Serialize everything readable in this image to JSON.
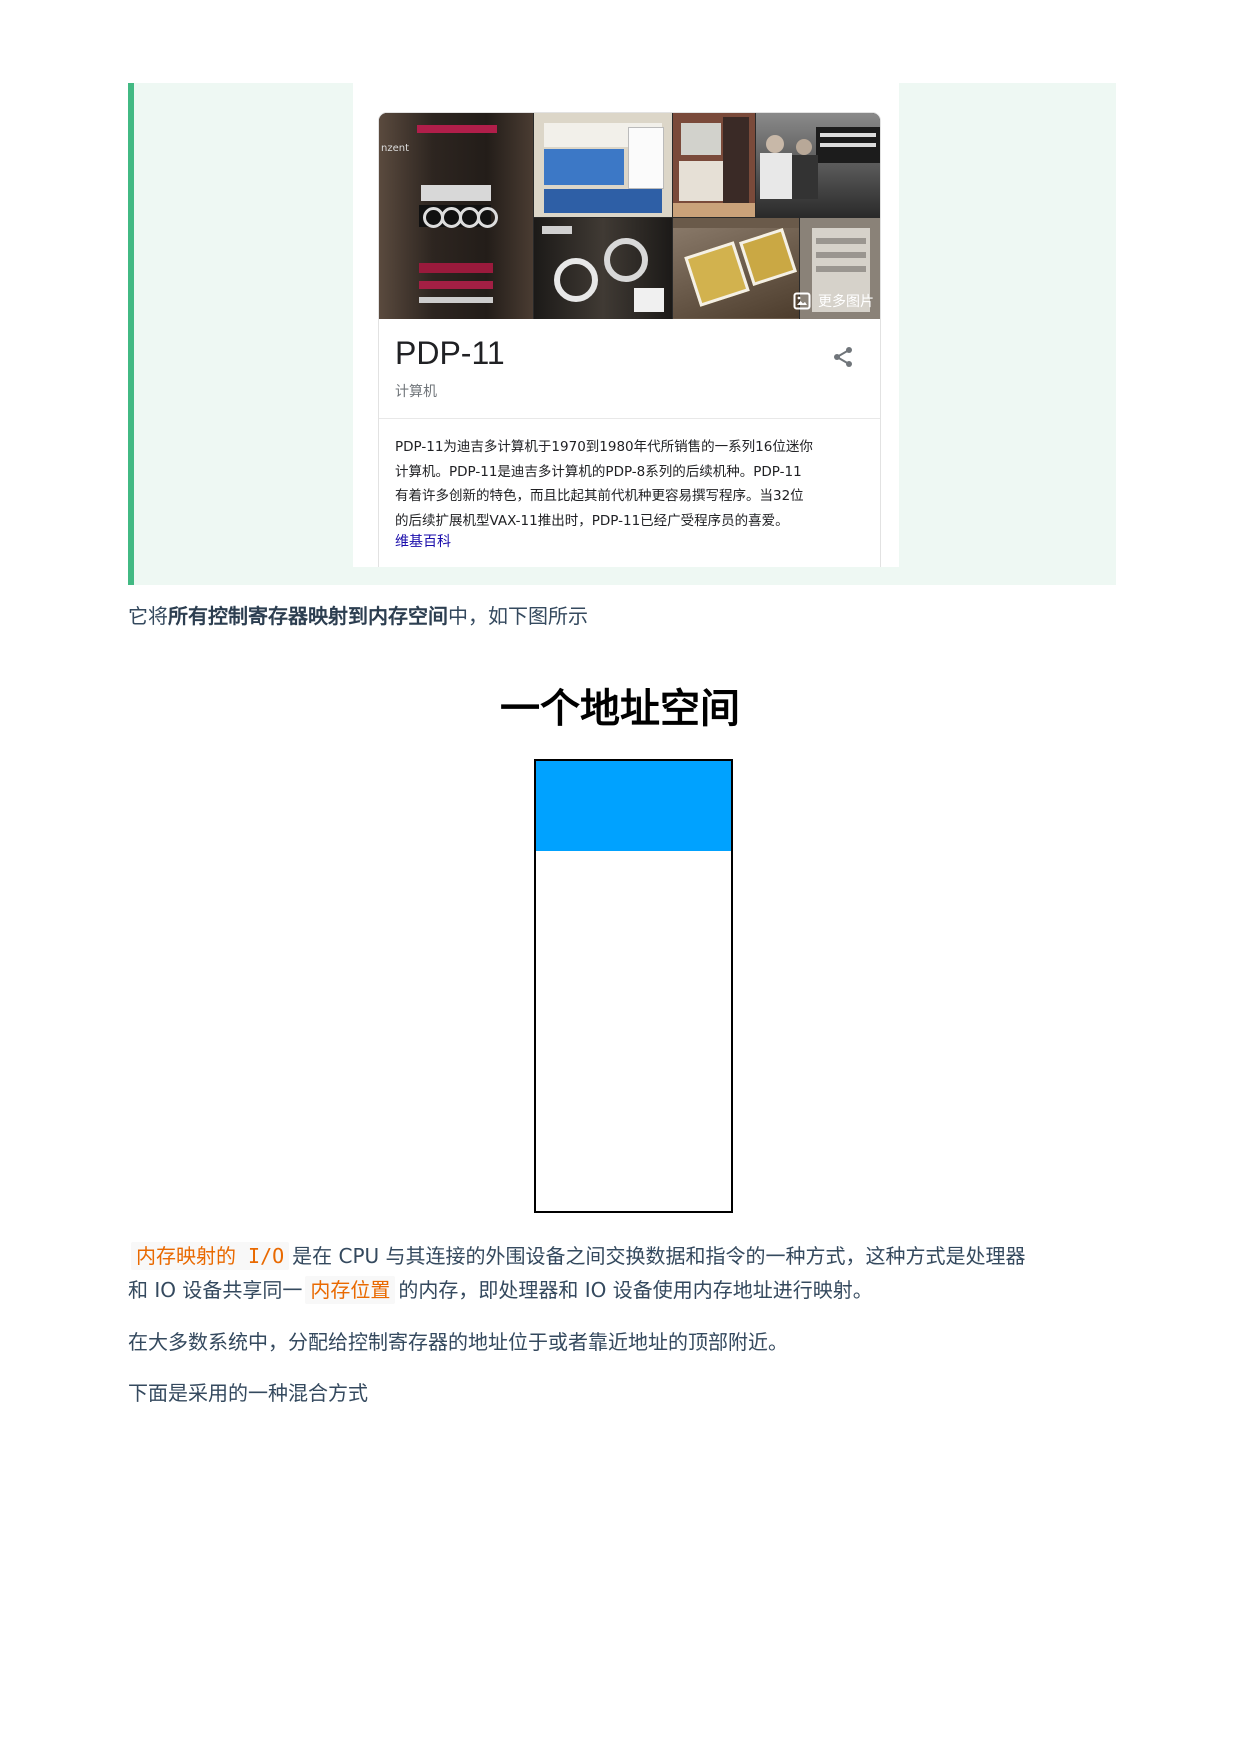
{
  "knowledge_card": {
    "title": "PDP-11",
    "subtitle": "计算机",
    "more_images_label": "更多图片",
    "description": "PDP-11为迪吉多计算机于1970到1980年代所销售的一系列16位迷你计算机。PDP-11是迪吉多计算机的PDP-8系列的后续机种。PDP-11有着许多创新的特色，而且比起其前代机种更容易撰写程序。当32位的后续扩展机型VAX-11推出时，PDP-11已经广受程序员的喜爱。",
    "desc_lines": [
      "PDP-11为迪吉多计算机于1970到1980年代所销售的一系列16位迷你",
      "计算机。PDP-11是迪吉多计算机的PDP-8系列的后续机种。PDP-11",
      "有着许多创新的特色，而且比起其前代机种更容易撰写程序。当32位",
      "的后续扩展机型VAX-11推出时，PDP-11已经广受程序员的喜爱。"
    ],
    "source_link": "维基百科",
    "photo_text": "nzent",
    "icons": [
      "image-icon",
      "share-icon"
    ]
  },
  "para1": {
    "before": "它将",
    "bold": "所有控制寄存器映射到内存空间",
    "after": "中，如下图所示"
  },
  "diagram": {
    "title": "一个地址空间",
    "io_region_color": "#00a2ff",
    "io_region_fraction_of_space": 0.2
  },
  "para2": {
    "code1": "内存映射的 I/O",
    "part1": "是在 CPU 与其连接的外围设备之间交换数据和指令的一种方式，这种方式是处理器",
    "part2": "和 IO 设备共享同一",
    "code2": "内存位置",
    "part3": "的内存，即处理器和 IO 设备使用内存地址进行映射。"
  },
  "para3": "在大多数系统中，分配给控制寄存器的地址位于或者靠近地址的顶部附近。",
  "para4": "下面是采用的一种混合方式",
  "colors": {
    "quote_bar": "#42b983",
    "quote_bg": "#eef8f3",
    "inline_code": "#e96900",
    "body_text": "#34495e",
    "link": "#1a0dab"
  }
}
